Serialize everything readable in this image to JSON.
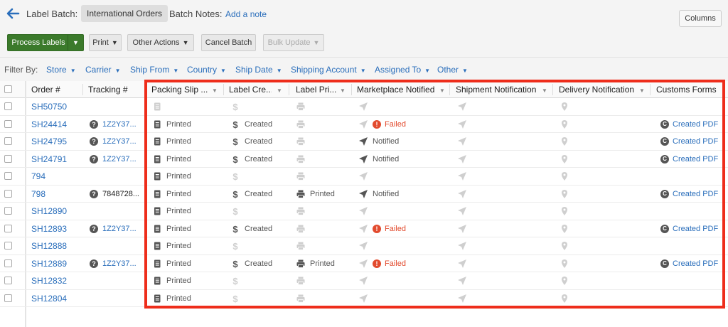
{
  "header": {
    "label_batch": "Label Batch:",
    "batch_name": "International Orders",
    "batch_notes": "Batch Notes:",
    "add_note": "Add a note",
    "columns": "Columns"
  },
  "toolbar": {
    "process_labels": "Process Labels",
    "print": "Print",
    "other_actions": "Other Actions",
    "cancel_batch": "Cancel Batch",
    "bulk_update": "Bulk Update"
  },
  "filters": {
    "label": "Filter By:",
    "items": [
      "Store",
      "Carrier",
      "Ship From",
      "Country",
      "Ship Date",
      "Shipping Account",
      "Assigned To",
      "Other"
    ]
  },
  "columns": {
    "order": "Order #",
    "tracking": "Tracking #",
    "packing_slip": "Packing Slip ...",
    "label_created": "Label Cre...",
    "label_printed": "Label Pri...",
    "marketplace": "Marketplace Notified",
    "shipment_notification": "Shipment Notification",
    "delivery_notification": "Delivery Notification",
    "customs_forms": "Customs Forms"
  },
  "rows": [
    {
      "order": "SH50750",
      "tracking": "",
      "packing": "",
      "label": "",
      "printed": "",
      "market": "",
      "customs": ""
    },
    {
      "order": "SH24414",
      "tracking": "1Z2Y37...",
      "packing": "Printed",
      "label": "Created",
      "printed": "",
      "market": "Failed",
      "customs": "Created PDF"
    },
    {
      "order": "SH24795",
      "tracking": "1Z2Y37...",
      "packing": "Printed",
      "label": "Created",
      "printed": "",
      "market": "Notified",
      "customs": "Created PDF"
    },
    {
      "order": "SH24791",
      "tracking": "1Z2Y37...",
      "packing": "Printed",
      "label": "Created",
      "printed": "",
      "market": "Notified",
      "customs": "Created PDF"
    },
    {
      "order": "794",
      "tracking": "",
      "packing": "Printed",
      "label": "",
      "printed": "",
      "market": "",
      "customs": ""
    },
    {
      "order": "798",
      "tracking": "7848728...",
      "packing": "Printed",
      "label": "Created",
      "printed": "Printed",
      "market": "Notified",
      "customs": "Created PDF"
    },
    {
      "order": "SH12890",
      "tracking": "",
      "packing": "Printed",
      "label": "",
      "printed": "",
      "market": "",
      "customs": ""
    },
    {
      "order": "SH12893",
      "tracking": "1Z2Y37...",
      "packing": "Printed",
      "label": "Created",
      "printed": "",
      "market": "Failed",
      "customs": "Created PDF"
    },
    {
      "order": "SH12888",
      "tracking": "",
      "packing": "Printed",
      "label": "",
      "printed": "",
      "market": "",
      "customs": ""
    },
    {
      "order": "SH12889",
      "tracking": "1Z2Y37...",
      "packing": "Printed",
      "label": "Created",
      "printed": "Printed",
      "market": "Failed",
      "customs": "Created PDF"
    },
    {
      "order": "SH12832",
      "tracking": "",
      "packing": "Printed",
      "label": "",
      "printed": "",
      "market": "",
      "customs": ""
    },
    {
      "order": "SH12804",
      "tracking": "",
      "packing": "Printed",
      "label": "",
      "printed": "",
      "market": "",
      "customs": ""
    }
  ],
  "colors": {
    "accent": "#2a6ebb",
    "primary_button": "#3b7a2b",
    "failed": "#e24b2e",
    "highlight": "#ee2d1b"
  }
}
